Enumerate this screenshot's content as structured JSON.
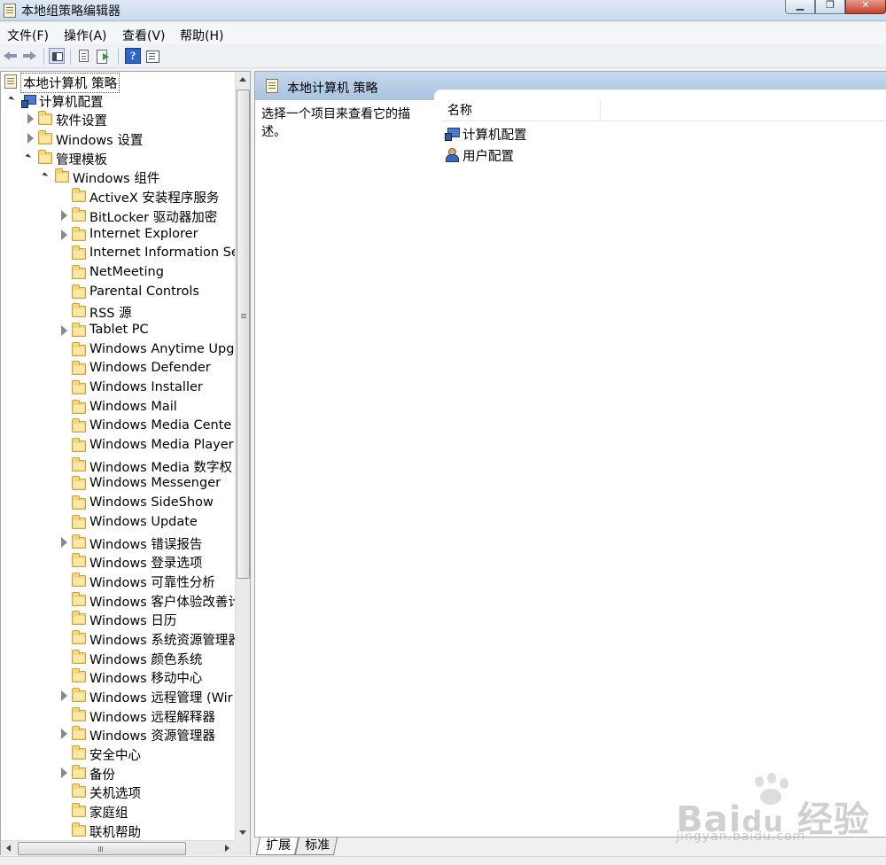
{
  "window": {
    "title": "本地组策略编辑器"
  },
  "menu": [
    {
      "label": "文件(F)"
    },
    {
      "label": "操作(A)"
    },
    {
      "label": "查看(V)"
    },
    {
      "label": "帮助(H)"
    }
  ],
  "tree": {
    "root": "本地计算机 策略",
    "computer_config": "计算机配置",
    "software_settings": "软件设置",
    "windows_settings": "Windows 设置",
    "admin_templates": "管理模板",
    "windows_components": "Windows 组件",
    "items": [
      {
        "label": "ActiveX 安装程序服务",
        "expandable": false
      },
      {
        "label": "BitLocker 驱动器加密",
        "expandable": true
      },
      {
        "label": "Internet Explorer",
        "expandable": true
      },
      {
        "label": "Internet Information Se",
        "expandable": false
      },
      {
        "label": "NetMeeting",
        "expandable": false
      },
      {
        "label": "Parental Controls",
        "expandable": false
      },
      {
        "label": "RSS 源",
        "expandable": false
      },
      {
        "label": "Tablet PC",
        "expandable": true
      },
      {
        "label": "Windows Anytime Upg",
        "expandable": false
      },
      {
        "label": "Windows Defender",
        "expandable": false
      },
      {
        "label": "Windows Installer",
        "expandable": false
      },
      {
        "label": "Windows Mail",
        "expandable": false
      },
      {
        "label": "Windows Media Cente",
        "expandable": false
      },
      {
        "label": "Windows Media Player",
        "expandable": false
      },
      {
        "label": "Windows Media 数字权",
        "expandable": false
      },
      {
        "label": "Windows Messenger",
        "expandable": false
      },
      {
        "label": "Windows SideShow",
        "expandable": false
      },
      {
        "label": "Windows Update",
        "expandable": false
      },
      {
        "label": "Windows 错误报告",
        "expandable": true
      },
      {
        "label": "Windows 登录选项",
        "expandable": false
      },
      {
        "label": "Windows 可靠性分析",
        "expandable": false
      },
      {
        "label": "Windows 客户体验改善计",
        "expandable": false
      },
      {
        "label": "Windows 日历",
        "expandable": false
      },
      {
        "label": "Windows 系统资源管理器",
        "expandable": false
      },
      {
        "label": "Windows 颜色系统",
        "expandable": false
      },
      {
        "label": "Windows 移动中心",
        "expandable": false
      },
      {
        "label": "Windows 远程管理 (Wir",
        "expandable": true
      },
      {
        "label": "Windows 远程解释器",
        "expandable": false
      },
      {
        "label": "Windows 资源管理器",
        "expandable": true
      },
      {
        "label": "安全中心",
        "expandable": false
      },
      {
        "label": "备份",
        "expandable": true
      },
      {
        "label": "关机选项",
        "expandable": false
      },
      {
        "label": "家庭组",
        "expandable": false
      },
      {
        "label": "联机帮助",
        "expandable": false
      }
    ]
  },
  "right_pane": {
    "header_title": "本地计算机 策略",
    "description": "选择一个项目来查看它的描述。",
    "column_name": "名称",
    "rows": [
      {
        "label": "计算机配置",
        "icon": "computer-config-icon"
      },
      {
        "label": "用户配置",
        "icon": "user-config-icon"
      }
    ]
  },
  "bottom_tabs": [
    {
      "label": "扩展",
      "active": true
    },
    {
      "label": "标准",
      "active": false
    }
  ],
  "scroll": {
    "vertical_position": 0.0
  },
  "watermark": {
    "text": "Bai经验",
    "sub": "jingyan.baidu.com"
  }
}
